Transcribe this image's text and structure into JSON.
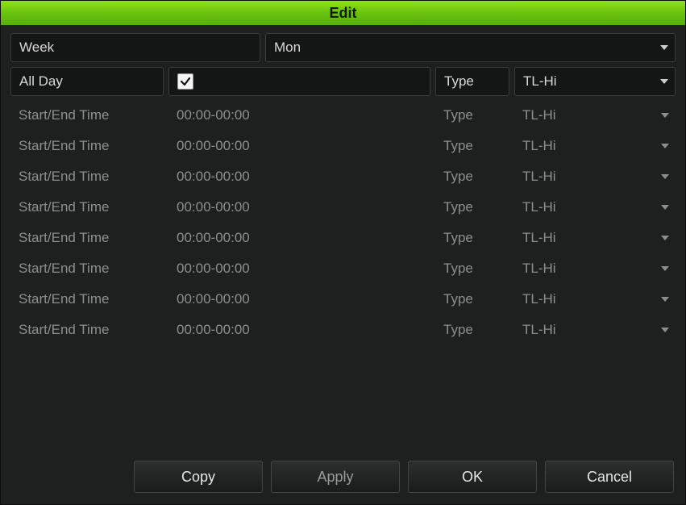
{
  "title": "Edit",
  "week": {
    "label": "Week",
    "value": "Mon"
  },
  "allday": {
    "label": "All Day",
    "checked": true,
    "type_label": "Type",
    "type_value": "TL-Hi"
  },
  "rows": [
    {
      "label": "Start/End Time",
      "time": "00:00-00:00",
      "type_label": "Type",
      "type_value": "TL-Hi"
    },
    {
      "label": "Start/End Time",
      "time": "00:00-00:00",
      "type_label": "Type",
      "type_value": "TL-Hi"
    },
    {
      "label": "Start/End Time",
      "time": "00:00-00:00",
      "type_label": "Type",
      "type_value": "TL-Hi"
    },
    {
      "label": "Start/End Time",
      "time": "00:00-00:00",
      "type_label": "Type",
      "type_value": "TL-Hi"
    },
    {
      "label": "Start/End Time",
      "time": "00:00-00:00",
      "type_label": "Type",
      "type_value": "TL-Hi"
    },
    {
      "label": "Start/End Time",
      "time": "00:00-00:00",
      "type_label": "Type",
      "type_value": "TL-Hi"
    },
    {
      "label": "Start/End Time",
      "time": "00:00-00:00",
      "type_label": "Type",
      "type_value": "TL-Hi"
    },
    {
      "label": "Start/End Time",
      "time": "00:00-00:00",
      "type_label": "Type",
      "type_value": "TL-Hi"
    }
  ],
  "buttons": {
    "copy": "Copy",
    "apply": "Apply",
    "ok": "OK",
    "cancel": "Cancel"
  }
}
